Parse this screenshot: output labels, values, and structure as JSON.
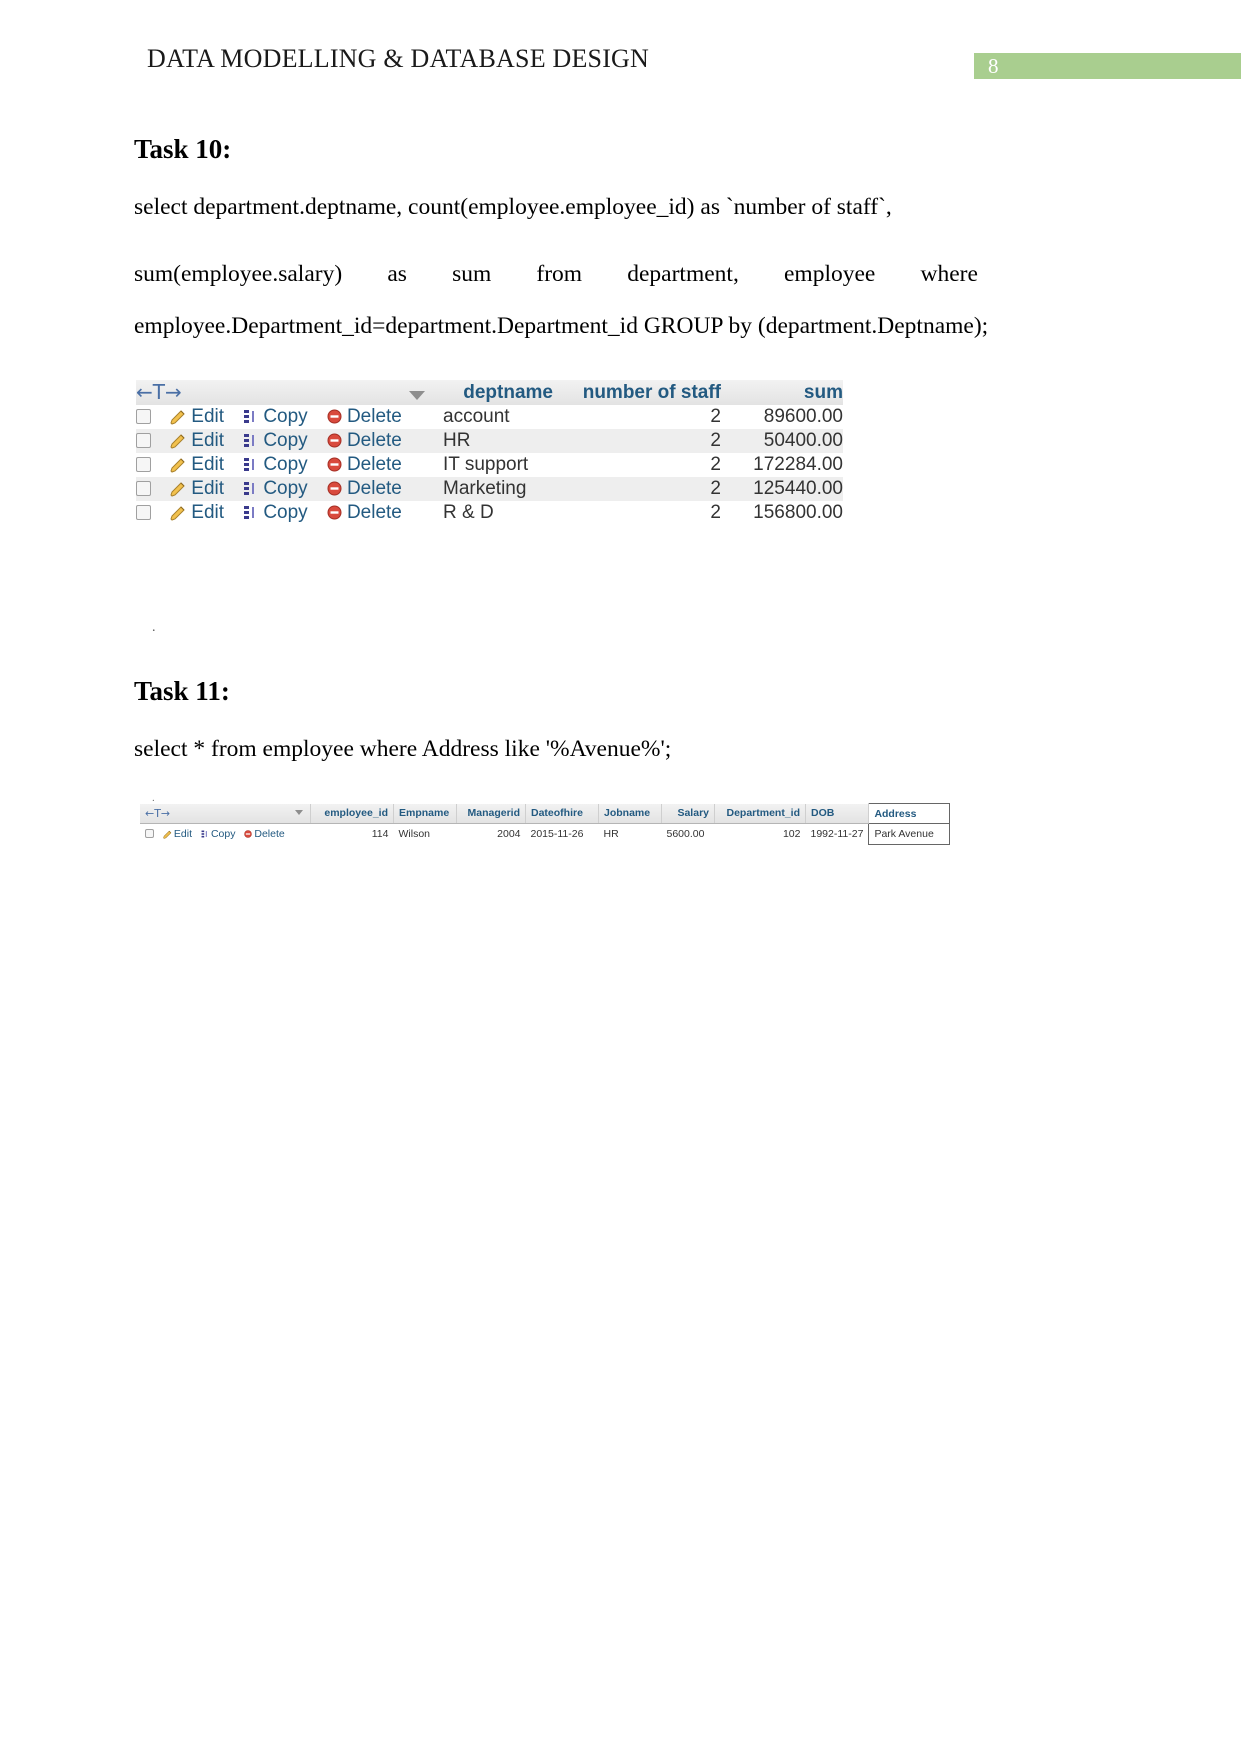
{
  "header": {
    "title": "DATA MODELLING & DATABASE DESIGN",
    "page_number": "8",
    "badge_color": "#a9ce8f"
  },
  "tasks": [
    {
      "heading": "Task 10:",
      "sql_line1": "select department.deptname, count(employee.employee_id) as `number of staff`,",
      "sql_line2_parts": [
        "sum(employee.salary)",
        "as",
        "sum",
        "from",
        "department,",
        "employee",
        "where"
      ],
      "sql_line3": "employee.Department_id=department.Department_id GROUP by (department.Deptname);"
    },
    {
      "heading": "Task 11:",
      "sql_line1": "select * from employee where Address like '%Avenue%';"
    }
  ],
  "result_table_1": {
    "actions_header": "←T→",
    "columns": [
      "deptname",
      "number of staff",
      "sum"
    ],
    "row_actions": {
      "edit": "Edit",
      "copy": "Copy",
      "delete": "Delete"
    },
    "rows": [
      {
        "deptname": "account",
        "number_of_staff": "2",
        "sum": "89600.00"
      },
      {
        "deptname": "HR",
        "number_of_staff": "2",
        "sum": "50400.00"
      },
      {
        "deptname": "IT support",
        "number_of_staff": "2",
        "sum": "172284.00"
      },
      {
        "deptname": "Marketing",
        "number_of_staff": "2",
        "sum": "125440.00"
      },
      {
        "deptname": "R & D",
        "number_of_staff": "2",
        "sum": "156800.00"
      }
    ]
  },
  "result_table_2": {
    "actions_header": "←T→",
    "columns": [
      "employee_id",
      "Empname",
      "Managerid",
      "Dateofhire",
      "Jobname",
      "Salary",
      "Department_id",
      "DOB",
      "Address"
    ],
    "row_actions": {
      "edit": "Edit",
      "copy": "Copy",
      "delete": "Delete"
    },
    "rows": [
      {
        "employee_id": "114",
        "Empname": "Wilson",
        "Managerid": "2004",
        "Dateofhire": "2015-11-26",
        "Jobname": "HR",
        "Salary": "5600.00",
        "Department_id": "102",
        "DOB": "1992-11-27",
        "Address": "Park Avenue"
      }
    ]
  }
}
